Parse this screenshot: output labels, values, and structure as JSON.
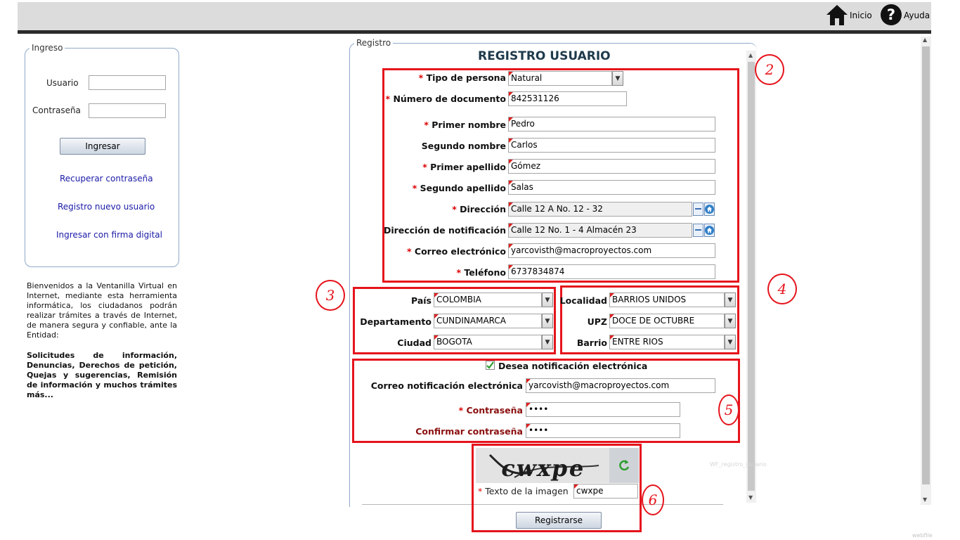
{
  "header": {
    "inicio_label": "Inicio",
    "ayuda_label": "Ayuda"
  },
  "login": {
    "legend": "Ingreso",
    "usuario_label": "Usuario",
    "contrasena_label": "Contraseña",
    "submit_label": "Ingresar",
    "links": [
      "Recuperar contraseña",
      "Registro nuevo usuario",
      "Ingresar con firma digital"
    ]
  },
  "welcome": {
    "text": "Bienvenidos a la Ventanilla Virtual en Internet, mediante esta herramienta informática, los ciudadanos podrán realizar trámites a través de Internet, de manera segura y confiable, ante la Entidad:",
    "bold_text": "Solicitudes de información, Denuncias, Derechos de petición, Quejas y sugerencias, Remisión de información y muchos trámites más..."
  },
  "registro": {
    "legend": "Registro",
    "title": "REGISTRO USUARIO",
    "fields": {
      "tipo_persona": {
        "label": "Tipo de persona",
        "value": "Natural"
      },
      "numero_documento": {
        "label": "Número de documento",
        "value": "842531126"
      },
      "primer_nombre": {
        "label": "Primer nombre",
        "value": "Pedro"
      },
      "segundo_nombre": {
        "label": "Segundo nombre",
        "value": "Carlos"
      },
      "primer_apellido": {
        "label": "Primer apellido",
        "value": "Gómez"
      },
      "segundo_apellido": {
        "label": "Segundo apellido",
        "value": "Salas"
      },
      "direccion": {
        "label": "Dirección",
        "value": "Calle 12 A No. 12 - 32"
      },
      "direccion_notificacion": {
        "label": "Dirección de notificación",
        "value": "Calle 12 No. 1 - 4 Almacén 23"
      },
      "correo": {
        "label": "Correo electrónico",
        "value": "yarcovisth@macroproyectos.com"
      },
      "telefono": {
        "label": "Teléfono",
        "value": "6737834874"
      }
    },
    "ubicacion": {
      "pais": {
        "label": "País",
        "value": "COLOMBIA"
      },
      "departamento": {
        "label": "Departamento",
        "value": "CUNDINAMARCA"
      },
      "ciudad": {
        "label": "Ciudad",
        "value": "BOGOTA"
      },
      "localidad": {
        "label": "Localidad",
        "value": "BARRIOS UNIDOS"
      },
      "upz": {
        "label": "UPZ",
        "value": "DOCE DE OCTUBRE"
      },
      "barrio": {
        "label": "Barrio",
        "value": "ENTRE RIOS"
      }
    },
    "notificacion": {
      "checkbox_label": "Desea notificación electrónica",
      "checked": true,
      "correo_label": "Correo notificación electrónica",
      "correo_value": "yarcovisth@macroproyectos.com",
      "contrasena_label": "Contraseña",
      "contrasena_value": "••••",
      "confirmar_label": "Confirmar contraseña",
      "confirmar_value": "••••"
    },
    "captcha": {
      "image_text": "cwxpe",
      "label": "Texto de la imagen",
      "value": "cwxpe"
    },
    "submit_label": "Registrarse",
    "ghost_text": "WF_registro_usuario"
  },
  "annotations": [
    "2",
    "3",
    "4",
    "5",
    "6"
  ],
  "footer_ghost": "webfile",
  "colors": {
    "required": "#dd0000",
    "annotation_red": "#e5141c",
    "link_blue": "#1a1aa8",
    "title": "#1e3a4c"
  }
}
